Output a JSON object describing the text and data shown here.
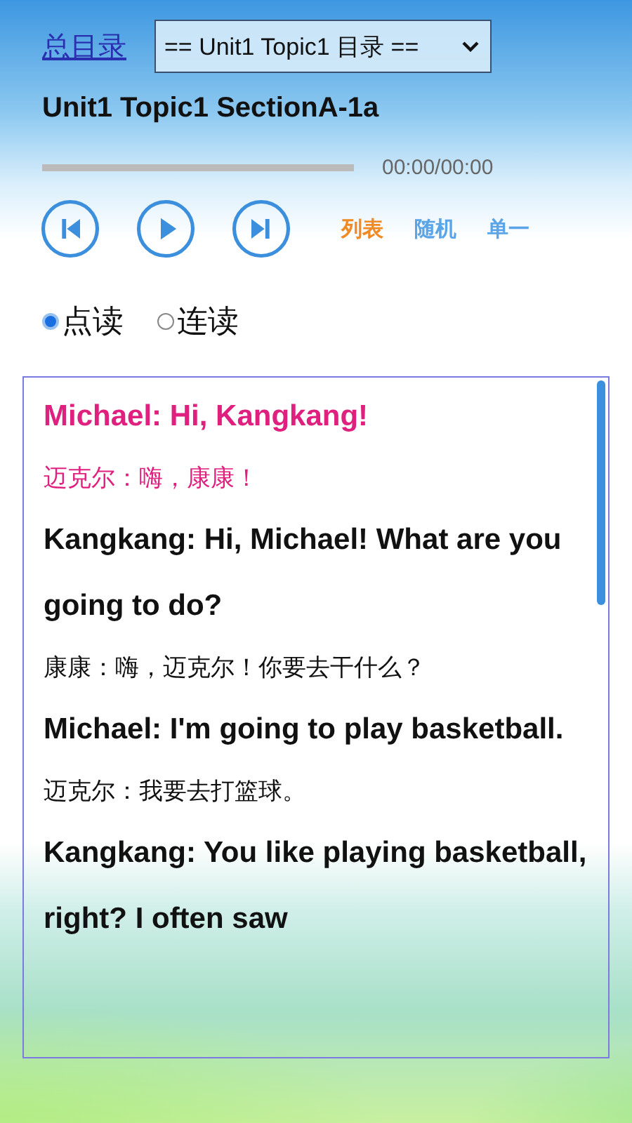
{
  "header": {
    "home_link": "总目录",
    "catalog_select": {
      "value": "== Unit1 Topic1 目录 =="
    }
  },
  "lesson_title": "Unit1 Topic1 SectionA-1a",
  "player": {
    "time": "00:00/00:00",
    "buttons": [
      {
        "kind": "previous"
      },
      {
        "kind": "play"
      },
      {
        "kind": "next"
      }
    ],
    "play_modes": [
      {
        "label": "列表",
        "selected": true
      },
      {
        "label": "随机",
        "selected": false
      },
      {
        "label": "单一",
        "selected": false
      }
    ]
  },
  "read_modes": [
    {
      "label": "点读",
      "selected": true
    },
    {
      "label": "连读",
      "selected": false
    }
  ],
  "dialogue": [
    {
      "english": "Michael: Hi, Kangkang!",
      "chinese": "迈克尔：嗨，康康！",
      "selected": true
    },
    {
      "english": "Kangkang: Hi, Michael! What are you going to do?",
      "chinese": "康康：嗨，迈克尔！你要去干什么？",
      "selected": false
    },
    {
      "english": "Michael: I'm going to play basketball.",
      "chinese": "迈克尔：我要去打篮球。",
      "selected": false
    },
    {
      "english": "Kangkang: You like playing basketball, right? I often saw",
      "selected": false
    }
  ]
}
